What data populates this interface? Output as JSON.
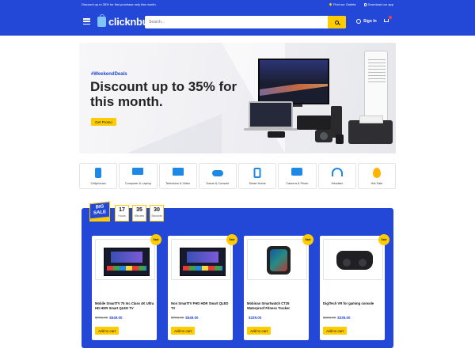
{
  "topbar": {
    "promo": "Discount up to 35% for first purchase only this month.",
    "find_store": "Find our Outlets",
    "download_app": "Download our app"
  },
  "header": {
    "logo": "clicknbuy",
    "search_placeholder": "Search...",
    "signin": "Sign In",
    "menu_icon": "hamburger-menu-icon",
    "cart_icon": "cart-icon",
    "cart_badge_color": "#ff3b3b"
  },
  "hero": {
    "tag": "#WeekendDeals",
    "title": "Discount up to 35% for this month.",
    "cta": "Get Promo"
  },
  "categories": [
    {
      "label": "Cellphones",
      "icon": "phone-icon"
    },
    {
      "label": "Computer & Laptop",
      "icon": "laptop-icon"
    },
    {
      "label": "Television & Video",
      "icon": "tv-icon"
    },
    {
      "label": "Game & Console",
      "icon": "gamepad-icon"
    },
    {
      "label": "Smart Home",
      "icon": "smart-home-icon"
    },
    {
      "label": "Camera & Photo",
      "icon": "camera-icon"
    },
    {
      "label": "Headset",
      "icon": "headset-icon"
    },
    {
      "label": "Hot Sale",
      "icon": "fire-icon"
    }
  ],
  "deals": {
    "badge_line1": "BIG",
    "badge_line2": "SALE",
    "timer": [
      {
        "value": "17",
        "unit": "Hours"
      },
      {
        "value": "35",
        "unit": "Minutes"
      },
      {
        "value": "30",
        "unit": "Seconds"
      }
    ],
    "products": [
      {
        "sale": "Sale",
        "title": "Mobile SmartTV 75 Inc Class 4K Ultra HD HDR Smart QLED TV",
        "old_price": "$799.00",
        "new_price": "$549.00",
        "cta": "Add to cart",
        "image": "smart-tv-image"
      },
      {
        "sale": "Sale",
        "title": "Non SmartTV FHD HDR Smart QLED TV",
        "old_price": "$799.00",
        "new_price": "$549.00",
        "cta": "Add to cart",
        "image": "qled-tv-image"
      },
      {
        "sale": "Sale",
        "title": "Mobinan Smartwatch CT25 Waterproof Fitness Tracker",
        "old_price": "",
        "new_price": "$339.00",
        "cta": "Add to cart",
        "image": "smartwatch-image"
      },
      {
        "sale": "Sale",
        "title": "DigiTech VR for gaming console",
        "old_price": "$499.00",
        "new_price": "$335.00",
        "cta": "Add to cart",
        "image": "vr-headset-image"
      }
    ]
  },
  "colors": {
    "brand_blue": "#2347d6",
    "accent_yellow": "#ffcc00"
  }
}
